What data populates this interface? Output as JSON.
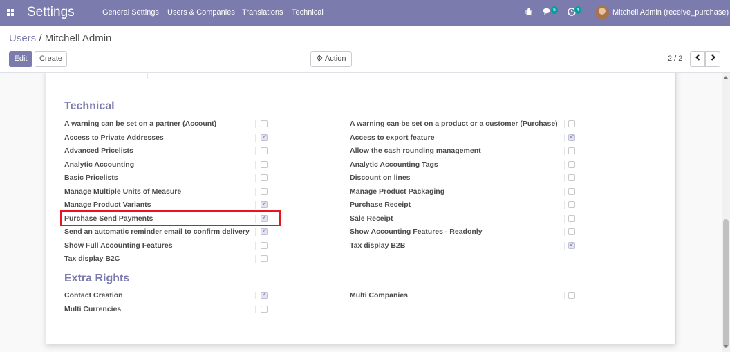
{
  "navbar": {
    "app_title": "Settings",
    "menu": [
      "General Settings",
      "Users & Companies",
      "Translations",
      "Technical"
    ],
    "messages_count": "5",
    "activities_count": "4",
    "user_label": "Mitchell Admin (receive_purchase)"
  },
  "breadcrumb": {
    "parent": "Users",
    "separator": "/",
    "current": "Mitchell Admin"
  },
  "buttons": {
    "edit": "Edit",
    "create": "Create",
    "action": "Action"
  },
  "pager": {
    "value": "2 / 2"
  },
  "technical": {
    "title": "Technical",
    "left": [
      {
        "label": "A warning can be set on a partner (Account)",
        "checked": false
      },
      {
        "label": "Access to Private Addresses",
        "checked": true
      },
      {
        "label": "Advanced Pricelists",
        "checked": false
      },
      {
        "label": "Analytic Accounting",
        "checked": false
      },
      {
        "label": "Basic Pricelists",
        "checked": false
      },
      {
        "label": "Manage Multiple Units of Measure",
        "checked": false
      },
      {
        "label": "Manage Product Variants",
        "checked": true
      },
      {
        "label": "Purchase Send Payments",
        "checked": true
      },
      {
        "label": "Send an automatic reminder email to confirm delivery",
        "checked": true
      },
      {
        "label": "Show Full Accounting Features",
        "checked": false
      },
      {
        "label": "Tax display B2C",
        "checked": false
      }
    ],
    "right": [
      {
        "label": "A warning can be set on a product or a customer (Purchase)",
        "checked": false
      },
      {
        "label": "Access to export feature",
        "checked": true
      },
      {
        "label": "Allow the cash rounding management",
        "checked": false
      },
      {
        "label": "Analytic Accounting Tags",
        "checked": false
      },
      {
        "label": "Discount on lines",
        "checked": false
      },
      {
        "label": "Manage Product Packaging",
        "checked": false
      },
      {
        "label": "Purchase Receipt",
        "checked": false
      },
      {
        "label": "Sale Receipt",
        "checked": false
      },
      {
        "label": "Show Accounting Features - Readonly",
        "checked": false
      },
      {
        "label": "Tax display B2B",
        "checked": true
      }
    ]
  },
  "extra_rights": {
    "title": "Extra Rights",
    "left": [
      {
        "label": "Contact Creation",
        "checked": true
      },
      {
        "label": "Multi Currencies",
        "checked": false
      }
    ],
    "right": [
      {
        "label": "Multi Companies",
        "checked": false
      }
    ]
  },
  "colors": {
    "brand": "#7c7bad",
    "highlight": "#e8141e"
  }
}
